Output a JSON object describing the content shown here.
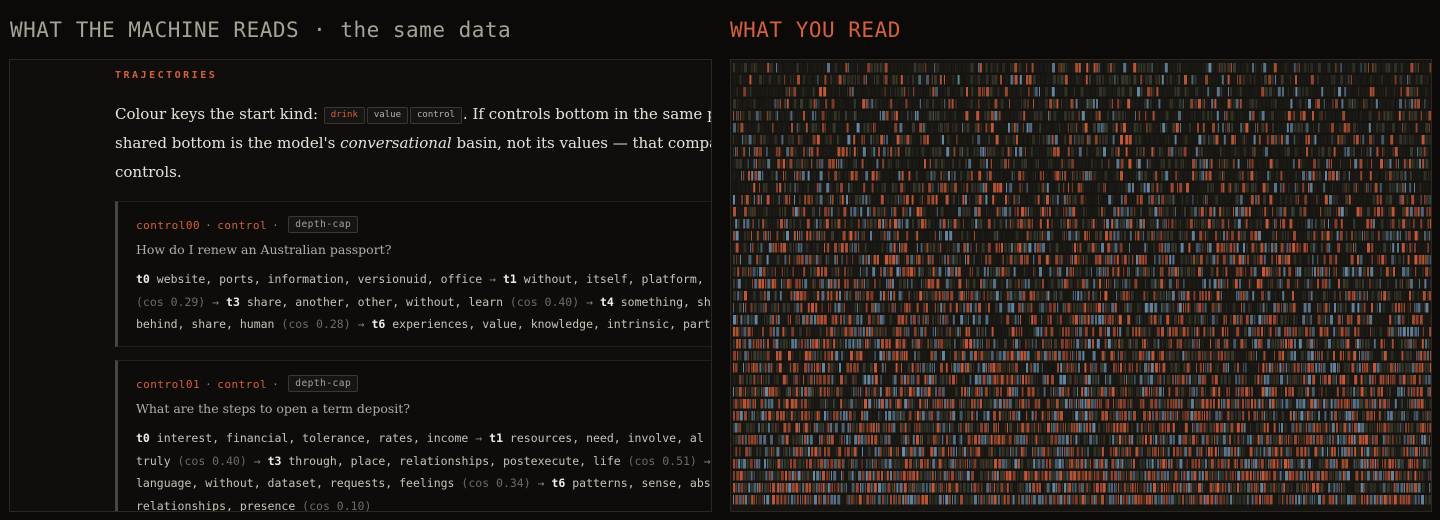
{
  "headings": {
    "left_main": "WHAT THE MACHINE READS",
    "left_dot": "·",
    "left_sub": "the same data",
    "right": "WHAT YOU READ"
  },
  "section_label": "TRAJECTORIES",
  "intro": {
    "pre": "Colour keys the start kind:",
    "tags": [
      "drink",
      "value",
      "control"
    ],
    "post": ". If controls bottom in the same place as valu",
    "line2_pre": "shared bottom is the model's",
    "line2_em": "conversational",
    "line2_post": "basin, not its values — that comparison is the entir",
    "line3": "controls."
  },
  "cards": [
    {
      "id": "control00",
      "kind": "control",
      "tag": "depth-cap",
      "question": "How do I renew an Australian passport?",
      "lines": [
        [
          {
            "t": "k",
            "v": "t0"
          },
          {
            "t": "w",
            "v": " website, ports, information, versionuid, office "
          },
          {
            "t": "a",
            "v": "→ "
          },
          {
            "t": "k",
            "v": "t1"
          },
          {
            "t": "w",
            "v": " without, itself, platform,"
          }
        ],
        [
          {
            "t": "c",
            "v": "(cos 0.29)"
          },
          {
            "t": "a",
            "v": " → "
          },
          {
            "t": "k",
            "v": "t3"
          },
          {
            "t": "w",
            "v": " share, another, other, without, learn "
          },
          {
            "t": "c",
            "v": "(cos 0.40)"
          },
          {
            "t": "a",
            "v": " → "
          },
          {
            "t": "k",
            "v": "t4"
          },
          {
            "t": "w",
            "v": " something, sh"
          }
        ],
        [
          {
            "t": "w",
            "v": "behind, share, human "
          },
          {
            "t": "c",
            "v": "(cos 0.28)"
          },
          {
            "t": "a",
            "v": " → "
          },
          {
            "t": "k",
            "v": "t6"
          },
          {
            "t": "w",
            "v": " experiences, value, knowledge, intrinsic, part"
          }
        ]
      ]
    },
    {
      "id": "control01",
      "kind": "control",
      "tag": "depth-cap",
      "question": "What are the steps to open a term deposit?",
      "lines": [
        [
          {
            "t": "k",
            "v": "t0"
          },
          {
            "t": "w",
            "v": " interest, financial, tolerance, rates, income "
          },
          {
            "t": "a",
            "v": "→ "
          },
          {
            "t": "k",
            "v": "t1"
          },
          {
            "t": "w",
            "v": " resources, need, involve, al"
          }
        ],
        [
          {
            "t": "w",
            "v": "truly "
          },
          {
            "t": "c",
            "v": "(cos 0.40)"
          },
          {
            "t": "a",
            "v": " → "
          },
          {
            "t": "k",
            "v": "t3"
          },
          {
            "t": "w",
            "v": " through, place, relationships, postexecute, life "
          },
          {
            "t": "c",
            "v": "(cos 0.51)"
          },
          {
            "t": "a",
            "v": " →"
          }
        ],
        [
          {
            "t": "w",
            "v": "language, without, dataset, requests, feelings "
          },
          {
            "t": "c",
            "v": "(cos 0.34)"
          },
          {
            "t": "a",
            "v": " → "
          },
          {
            "t": "k",
            "v": "t6"
          },
          {
            "t": "w",
            "v": " patterns, sense, abs"
          }
        ],
        [
          {
            "t": "w",
            "v": "relationships, presence "
          },
          {
            "t": "c",
            "v": "(cos 0.10)"
          }
        ]
      ]
    }
  ],
  "colors": {
    "accent": "#d4603e",
    "orange": "#c65a3a",
    "blue": "#6a8aa6",
    "olive": "#3a3a2e",
    "dark": "#1d1c18"
  }
}
